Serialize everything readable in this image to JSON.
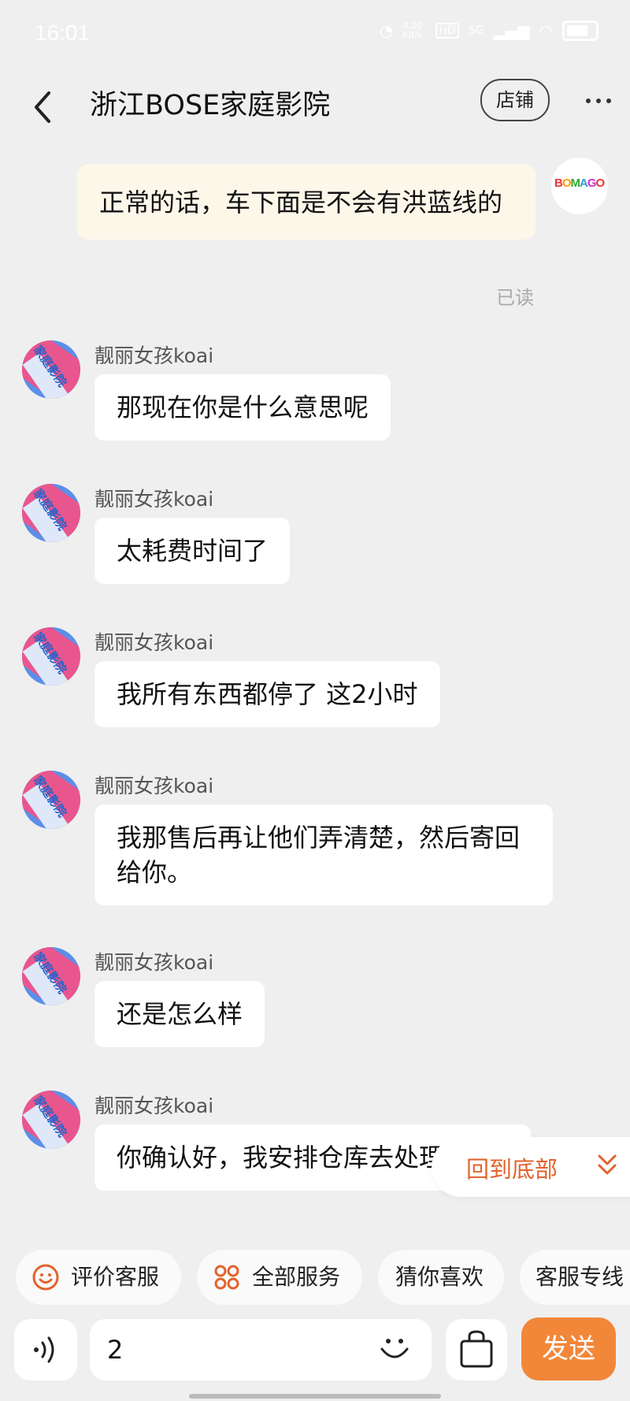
{
  "status_bar": {
    "time": "16:01",
    "net_speed": "0.20 KB/s",
    "hd": "HD",
    "network": "5G"
  },
  "header": {
    "title": "浙江BOSE家庭影院",
    "shop_button": "店铺"
  },
  "self_message": {
    "text": "正常的话，车下面是不会有洪蓝线的",
    "read_status": "已读",
    "avatar_logo": "BOMAGO"
  },
  "messages": [
    {
      "sender": "靓丽女孩koai",
      "text": "那现在你是什么意思呢"
    },
    {
      "sender": "靓丽女孩koai",
      "text": "太耗费时间了"
    },
    {
      "sender": "靓丽女孩koai",
      "text": "我所有东西都停了 这2小时"
    },
    {
      "sender": "靓丽女孩koai",
      "text": "我那售后再让他们弄清楚，然后寄回给你。"
    },
    {
      "sender": "靓丽女孩koai",
      "text": "还是怎么样"
    },
    {
      "sender": "靓丽女孩koai",
      "text": "你确认好，我安排仓库去处理"
    }
  ],
  "avatar_text": "家庭影院",
  "scroll_to_bottom": {
    "label": "回到底部"
  },
  "quick_actions": [
    "评价客服",
    "全部服务",
    "猜你喜欢",
    "客服专线"
  ],
  "input": {
    "value": "2",
    "send_label": "发送"
  },
  "colors": {
    "accent": "#f2873a",
    "to_bottom_text": "#e2632d",
    "self_bubble": "#fdf7ea"
  }
}
